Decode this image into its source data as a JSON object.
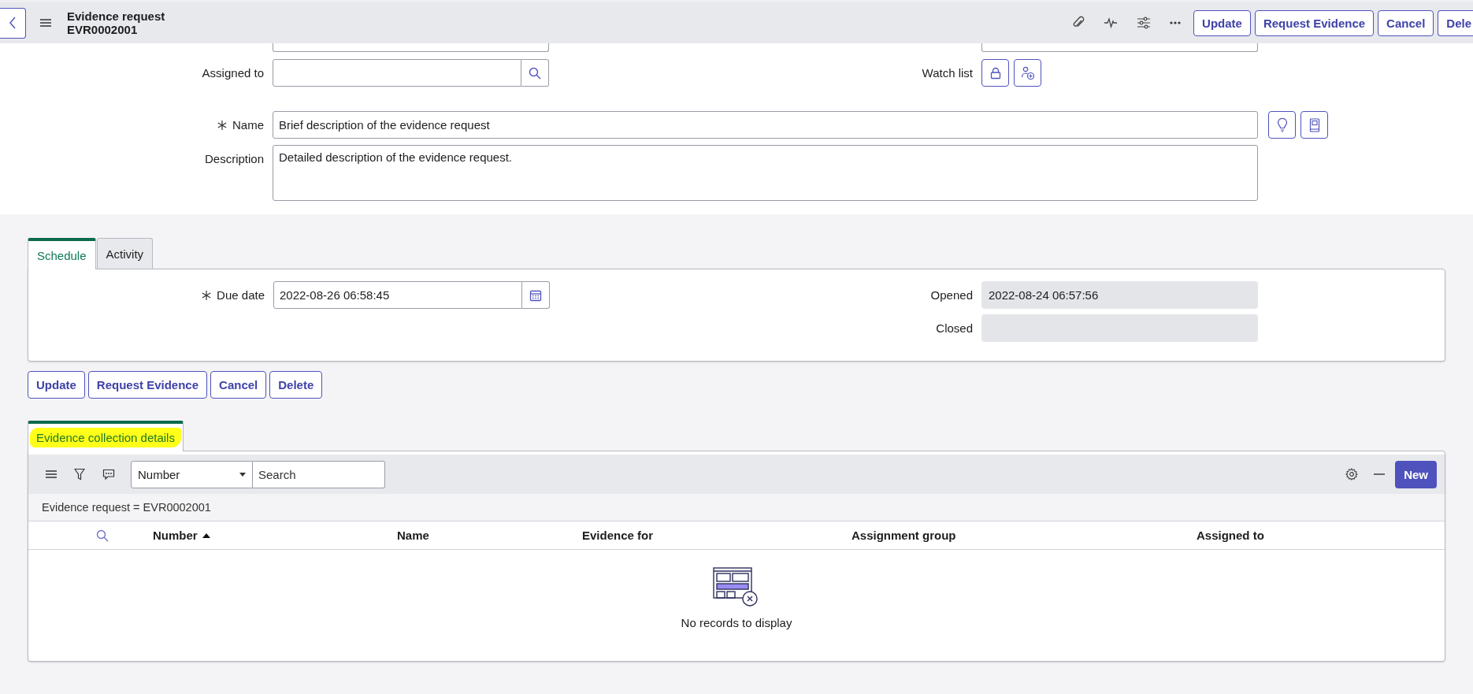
{
  "header": {
    "title": "Evidence request",
    "number": "EVR0002001",
    "buttons": [
      "Update",
      "Request Evidence",
      "Cancel",
      "Dele"
    ]
  },
  "form": {
    "left_fields": [
      {
        "label": "Assigned to",
        "kind": "reference",
        "required": false
      }
    ],
    "right_fields": [
      {
        "label": "Watch list",
        "kind": "watchlist",
        "required": false
      }
    ],
    "wide_fields": [
      {
        "label": "Name",
        "kind": "text",
        "required": true,
        "value": "Brief description of the evidence request"
      },
      {
        "label": "Description",
        "kind": "textarea",
        "required": false,
        "value": "Detailed description of the evidence request."
      }
    ]
  },
  "section_tabs": [
    {
      "label": "Schedule",
      "selected": true
    },
    {
      "label": "Activity",
      "selected": false
    }
  ],
  "schedule": {
    "left_fields": [
      {
        "label": "Due date",
        "kind": "date",
        "required": true,
        "value": "2022-08-26 06:58:45"
      }
    ],
    "right_fields": [
      {
        "label": "Opened",
        "kind": "readonly",
        "required": false,
        "value": "2022-08-24 06:57:56"
      },
      {
        "label": "Closed",
        "kind": "readonly",
        "required": false
      }
    ]
  },
  "form_buttons": [
    "Update",
    "Request Evidence",
    "Cancel",
    "Delete"
  ],
  "related_list": {
    "tab": {
      "label": "Evidence collection details",
      "selected": true,
      "highlighted": true
    },
    "search_column": "Number",
    "search_placeholder": "Search",
    "new_button": "New",
    "filter": "Evidence request = EVR0002001",
    "columns": [
      {
        "label": "Number",
        "sorted": true
      },
      {
        "label": "Name",
        "sorted": false
      },
      {
        "label": "Evidence for",
        "sorted": false
      },
      {
        "label": "Assignment group",
        "sorted": false
      },
      {
        "label": "Assigned to",
        "sorted": false
      }
    ],
    "empty_message": "No records to display"
  }
}
